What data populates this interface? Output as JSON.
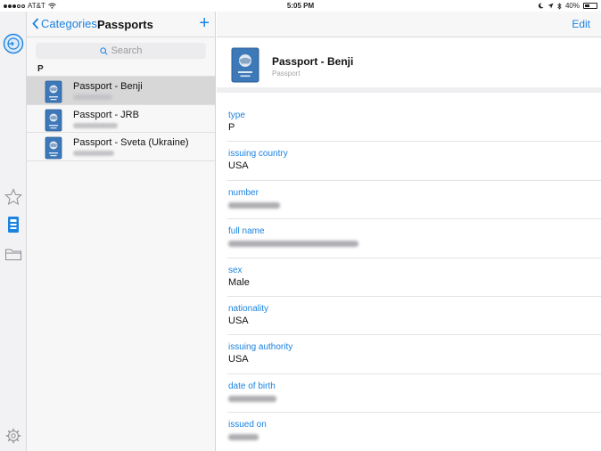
{
  "status_bar": {
    "carrier": "AT&T",
    "time": "5:05 PM",
    "battery": "40%",
    "battery_level": 0.4
  },
  "rail": {
    "icons": [
      "lock-badge-icon",
      "star-icon",
      "id-card-icon",
      "folder-icon",
      "settings-gear-icon"
    ]
  },
  "list": {
    "back_label": "Categories",
    "title": "Passports",
    "add_label": "+",
    "search_placeholder": "Search",
    "section_letter": "P",
    "items": [
      {
        "title": "Passport - Benji",
        "selected": true
      },
      {
        "title": "Passport - JRB",
        "selected": false
      },
      {
        "title": "Passport - Sveta (Ukraine)",
        "selected": false
      }
    ]
  },
  "detail": {
    "edit_label": "Edit",
    "title": "Passport - Benji",
    "subtitle": "Passport",
    "fields": [
      {
        "label": "type",
        "value": "P",
        "blurred": false
      },
      {
        "label": "issuing country",
        "value": "USA",
        "blurred": false
      },
      {
        "label": "number",
        "value": "",
        "blurred": true
      },
      {
        "label": "full name",
        "value": "",
        "blurred": true
      },
      {
        "label": "sex",
        "value": "Male",
        "blurred": false
      },
      {
        "label": "nationality",
        "value": "USA",
        "blurred": false
      },
      {
        "label": "issuing authority",
        "value": "USA",
        "blurred": false
      },
      {
        "label": "date of birth",
        "value": "",
        "blurred": true
      },
      {
        "label": "issued on",
        "value": "",
        "blurred": true
      }
    ]
  },
  "colors": {
    "accent": "#1a82e0",
    "passport_blue": "#3d78b8",
    "selected_row": "#d7d7d8"
  }
}
